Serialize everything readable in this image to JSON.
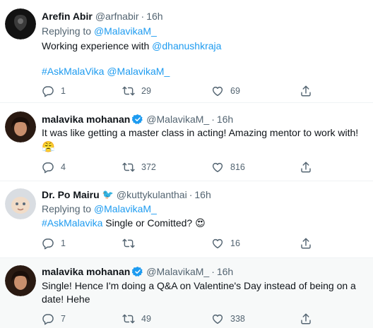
{
  "tweets": [
    {
      "name": "Arefin Abir",
      "handle": "@arfnabir",
      "sep": "·",
      "time": "16h",
      "reply_prefix": "Replying to ",
      "reply_to": "@MalavikaM_",
      "text1_plain": "Working experience with ",
      "text1_link": "@dhanushkraja",
      "hashtag": "#AskMalaVika",
      "mention": "@MalavikaM_",
      "stats": {
        "replies": "1",
        "retweets": "29",
        "likes": "69"
      }
    },
    {
      "name": "malavika mohanan",
      "handle": "@MalavikaM_",
      "sep": "·",
      "time": "16h",
      "text1": "It was like getting a master class in acting! Amazing mentor to work with!",
      "emoji": "😤",
      "stats": {
        "replies": "4",
        "retweets": "372",
        "likes": "816"
      }
    },
    {
      "name": "Dr. Po Mairu",
      "bird": "🐦",
      "handle": "@kuttykulanthai",
      "sep": "·",
      "time": "16h",
      "reply_prefix": "Replying to ",
      "reply_to": "@MalavikaM_",
      "hashtag": "#AskMalavika",
      "text1_plain": " Single or Comitted? ",
      "emoji": "😍",
      "stats": {
        "replies": "1",
        "retweets": "",
        "likes": "16"
      }
    },
    {
      "name": "malavika mohanan",
      "handle": "@MalavikaM_",
      "sep": "·",
      "time": "16h",
      "text1": "Single! Hence I'm doing a Q&A on Valentine's Day instead of being on a",
      "text2": "date! Hehe",
      "stats": {
        "replies": "7",
        "retweets": "49",
        "likes": "338"
      }
    }
  ],
  "colors": {
    "link": "#1d9bf0",
    "muted": "#536471",
    "text": "#0f1419",
    "verified": "#1d9bf0",
    "highlight_bg": "#f7f9f9"
  },
  "icons": [
    "reply-icon",
    "retweet-icon",
    "like-icon",
    "share-icon",
    "verified-badge-icon"
  ]
}
